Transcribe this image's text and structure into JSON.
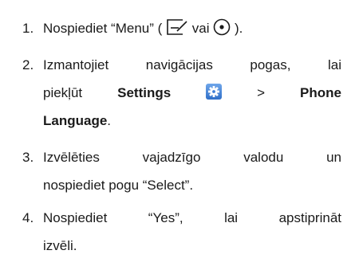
{
  "steps": [
    {
      "num": "1.",
      "pre": "Nospiediet “Menu” (",
      "mid": "vai",
      "post": ")."
    },
    {
      "num": "2.",
      "line1": "Izmantojiet navigācijas pogas, lai",
      "pre": "piekļūt",
      "settings": "Settings",
      "arrow": ">",
      "phone": "Phone",
      "language": "Language",
      "end": "."
    },
    {
      "num": "3.",
      "line1": "Izvēlēties vajadzīgo valodu un",
      "line2": "nospiediet pogu “Select”."
    },
    {
      "num": "4.",
      "line1": "Nospiediet “Yes”, lai apstiprināt",
      "line2": "izvēli."
    }
  ],
  "icons": {
    "menu_key": "menu-softkey-icon",
    "center_key": "center-select-icon",
    "settings": "settings-gear-icon"
  },
  "colors": {
    "text": "#1a1a1a",
    "settings_icon": "#3f7fd6"
  }
}
